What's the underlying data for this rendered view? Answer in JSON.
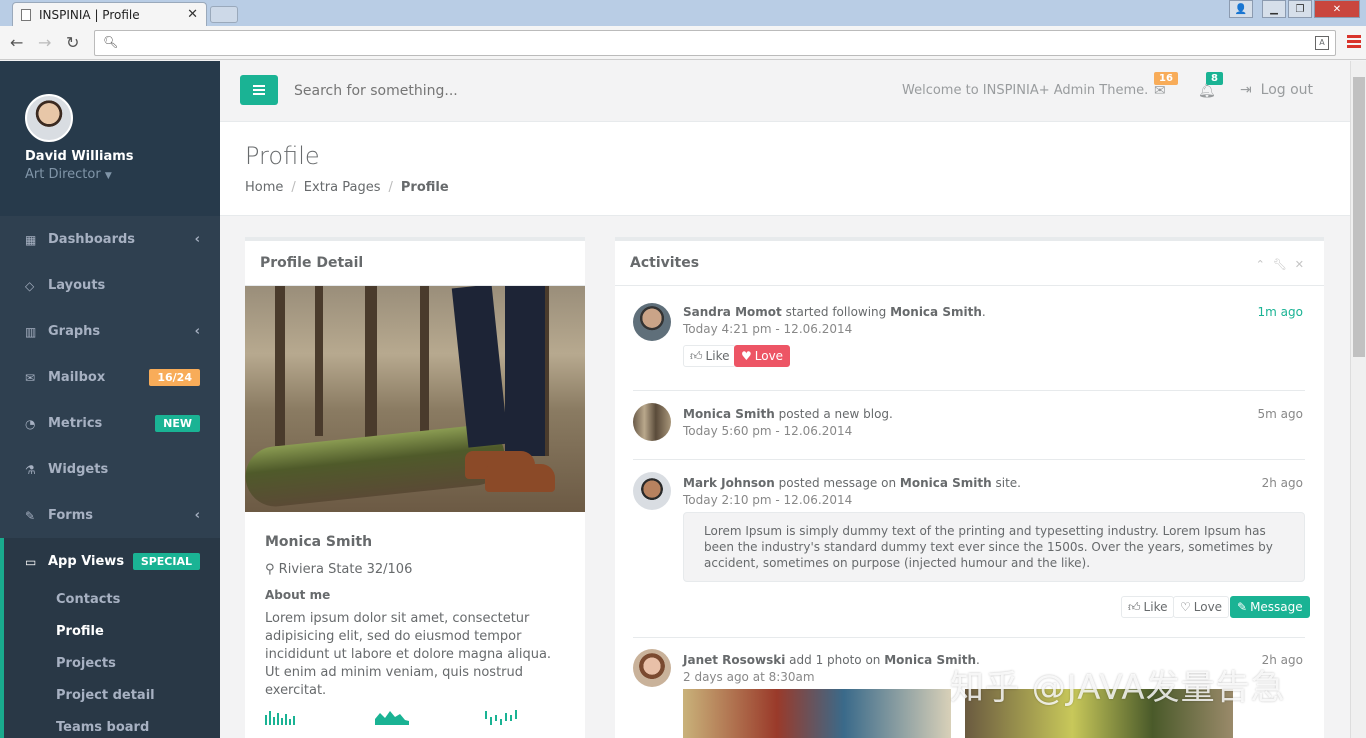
{
  "browser": {
    "tab_title": "INSPINIA | Profile",
    "tab_close": "✕"
  },
  "sidebar": {
    "user_name": "David Williams",
    "user_role": "Art Director",
    "items": [
      {
        "label": "Dashboards",
        "icon": "th-large-icon",
        "arrow": "‹"
      },
      {
        "label": "Layouts",
        "icon": "diamond-icon"
      },
      {
        "label": "Graphs",
        "icon": "bar-chart-icon",
        "arrow": "‹"
      },
      {
        "label": "Mailbox",
        "icon": "envelope-icon",
        "badge": "16/24",
        "badge_color": "#f8ac59"
      },
      {
        "label": "Metrics",
        "icon": "pie-chart-icon",
        "badge": "NEW",
        "badge_color": "#1ab394"
      },
      {
        "label": "Widgets",
        "icon": "flask-icon"
      },
      {
        "label": "Forms",
        "icon": "edit-icon",
        "arrow": "‹"
      },
      {
        "label": "App Views",
        "icon": "desktop-icon",
        "badge": "SPECIAL",
        "badge_color": "#1ab394"
      }
    ],
    "sub_items": [
      "Contacts",
      "Profile",
      "Projects",
      "Project detail",
      "Teams board"
    ]
  },
  "topnav": {
    "search_placeholder": "Search for something...",
    "welcome": "Welcome to INSPINIA+ Admin Theme.",
    "mail_count": "16",
    "bell_count": "8",
    "logout": "Log out"
  },
  "page": {
    "title": "Profile",
    "breadcrumb": [
      "Home",
      "Extra Pages",
      "Profile"
    ],
    "sep": "/"
  },
  "profile_detail": {
    "title": "Profile Detail",
    "name": "Monica Smith",
    "address": "Riviera State 32/106",
    "about_label": "About me",
    "about_text": "Lorem ipsum dolor sit amet, consectetur adipisicing elit, sed do eiusmod tempor incididunt ut labore et dolore magna aliqua. Ut enim ad minim veniam, quis nostrud exercitat."
  },
  "activities": {
    "title": "Activites",
    "feed": [
      {
        "actor": "Sandra Momot",
        "action": " started following ",
        "target": "Monica Smith",
        "tail": ".",
        "date": "Today 4:21 pm - 12.06.2014",
        "ago": "1m ago"
      },
      {
        "actor": "Monica Smith",
        "action": " posted a new blog.",
        "target": "",
        "tail": "",
        "date": "Today 5:60 pm - 12.06.2014",
        "ago": "5m ago"
      },
      {
        "actor": "Mark Johnson",
        "action": " posted message on ",
        "target": "Monica Smith",
        "tail": " site.",
        "date": "Today 2:10 pm - 12.06.2014",
        "ago": "2h ago"
      },
      {
        "actor": "Janet Rosowski",
        "action": " add 1 photo on ",
        "target": "Monica Smith",
        "tail": ".",
        "date": "2 days ago at 8:30am",
        "ago": "2h ago"
      }
    ],
    "quote": "Lorem Ipsum is simply dummy text of the printing and typesetting industry. Lorem Ipsum has been the industry's standard dummy text ever since the 1500s. Over the years, sometimes by accident, sometimes on purpose (injected humour and the like).",
    "like": "Like",
    "love": "Love",
    "message": "Message"
  },
  "watermark": "知乎 @JAVA发量告急"
}
